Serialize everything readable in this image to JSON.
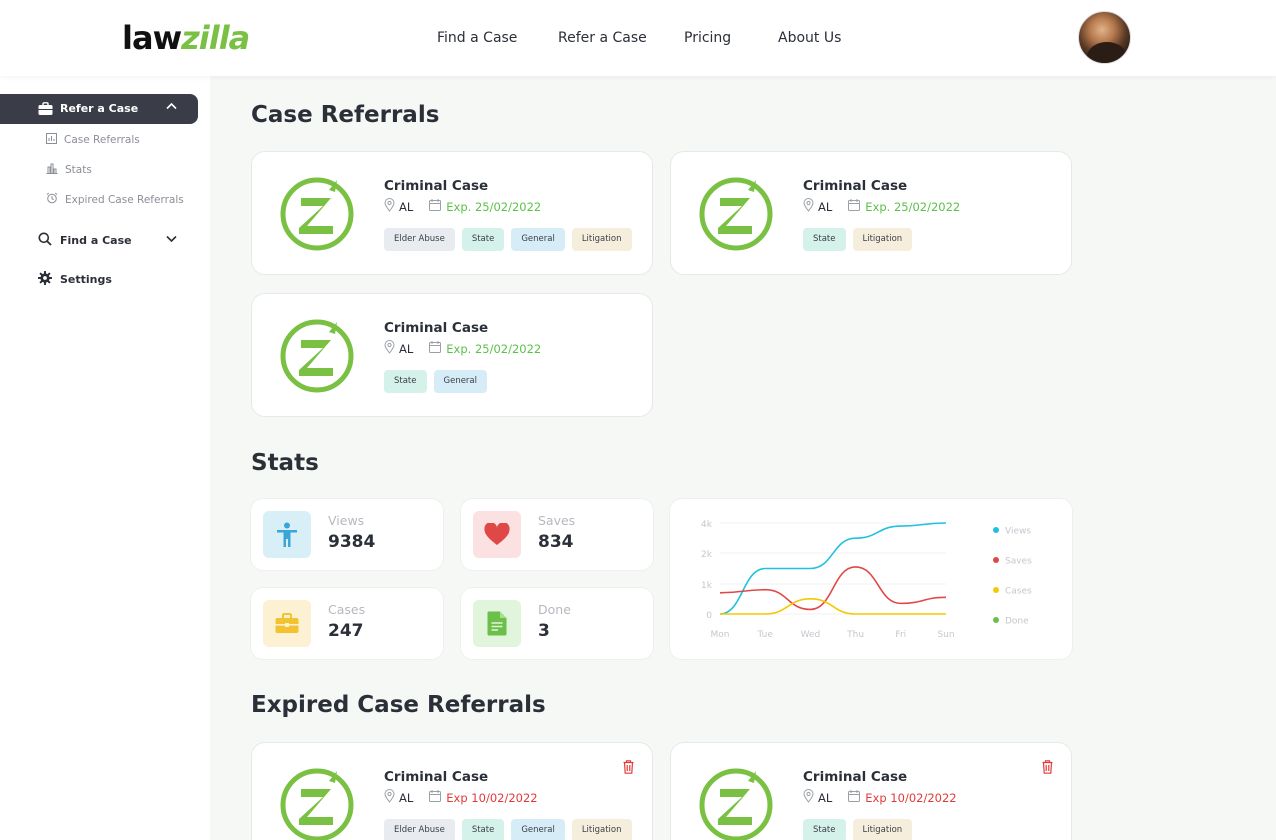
{
  "brand": {
    "logo_part1": "law",
    "logo_part2": "zilla",
    "green": "#7ac143"
  },
  "nav": {
    "items": [
      "Find a Case",
      "Refer a Case",
      "Pricing",
      "About Us"
    ]
  },
  "sidebar": {
    "refer": {
      "label": "Refer a Case",
      "icon": "briefcase-icon"
    },
    "sub_items": [
      {
        "label": "Case Referrals",
        "icon": "report-icon"
      },
      {
        "label": "Stats",
        "icon": "bar-chart-icon"
      },
      {
        "label": "Expired Case Referrals",
        "icon": "alarm-icon"
      }
    ],
    "find": {
      "label": "Find a Case",
      "icon": "search-icon"
    },
    "settings": {
      "label": "Settings",
      "icon": "gear-icon"
    }
  },
  "sections": {
    "referrals": "Case Referrals",
    "stats": "Stats",
    "expired": "Expired Case Referrals"
  },
  "referrals": [
    {
      "title": "Criminal Case",
      "location": "AL",
      "expiry": "Exp. 25/02/2022",
      "tags": [
        "Elder Abuse",
        "State",
        "General",
        "Litigation"
      ]
    },
    {
      "title": "Criminal Case",
      "location": "AL",
      "expiry": "Exp. 25/02/2022",
      "tags": [
        "State",
        "Litigation"
      ]
    },
    {
      "title": "Criminal Case",
      "location": "AL",
      "expiry": "Exp. 25/02/2022",
      "tags": [
        "State",
        "General"
      ]
    }
  ],
  "stats": [
    {
      "label": "Views",
      "value": "9384",
      "icon": "person-icon",
      "color": "#3aa6d8",
      "bg": "#d9eff8"
    },
    {
      "label": "Saves",
      "value": "834",
      "icon": "heart-icon",
      "color": "#e04848",
      "bg": "#fbe1e1"
    },
    {
      "label": "Cases",
      "value": "247",
      "icon": "briefcase-icon",
      "color": "#f2c230",
      "bg": "#fcf1d2"
    },
    {
      "label": "Done",
      "value": "3",
      "icon": "document-icon",
      "color": "#6cc04a",
      "bg": "#e1f4dc"
    }
  ],
  "chart_data": {
    "type": "line",
    "x": [
      "Mon",
      "Tue",
      "Wed",
      "Thu",
      "Fri",
      "Sun"
    ],
    "yticks": [
      "0",
      "1k",
      "2k",
      "4k"
    ],
    "series": [
      {
        "name": "Views",
        "color": "#1fc1e0",
        "values": [
          0,
          1.5,
          1.5,
          2.5,
          2.9,
          3.0
        ]
      },
      {
        "name": "Saves",
        "color": "#e04848",
        "values": [
          0.7,
          0.8,
          0.15,
          1.55,
          0.35,
          0.55
        ]
      },
      {
        "name": "Cases",
        "color": "#f5c800",
        "values": [
          0,
          0,
          0.5,
          0,
          0,
          0
        ]
      },
      {
        "name": "Done",
        "color": "#6cc04a",
        "values": []
      }
    ],
    "legend_position": "right"
  },
  "expired": [
    {
      "title": "Criminal Case",
      "location": "AL",
      "expiry": "Exp 10/02/2022",
      "tags": [
        "Elder Abuse",
        "State",
        "General",
        "Litigation"
      ]
    },
    {
      "title": "Criminal Case",
      "location": "AL",
      "expiry": "Exp 10/02/2022",
      "tags": [
        "State",
        "Litigation"
      ]
    }
  ]
}
